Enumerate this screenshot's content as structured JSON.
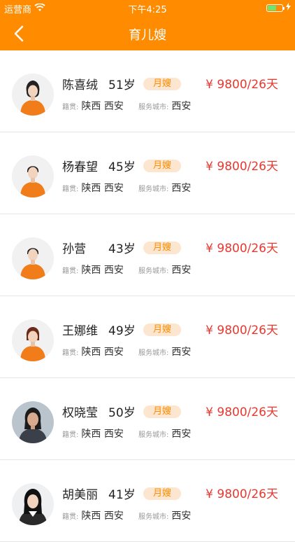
{
  "status_bar": {
    "carrier": "运营商",
    "time": "下午4:25",
    "battery_level": 0.55
  },
  "nav": {
    "title": "育儿嫂"
  },
  "colors": {
    "brand": "#ff8c00",
    "price": "#e8382f",
    "badge_bg": "#fde6cf"
  },
  "labels": {
    "origin": "籍贯:",
    "service_city": "服务城市:"
  },
  "nannies": [
    {
      "name": "陈喜绒",
      "age": "51岁",
      "type": "月嫂",
      "price": "¥ 9800/26天",
      "origin": "陕西 西安",
      "city": "西安"
    },
    {
      "name": "杨春望",
      "age": "45岁",
      "type": "月嫂",
      "price": "¥ 9800/26天",
      "origin": "陕西 西安",
      "city": "西安"
    },
    {
      "name": "孙营",
      "age": "43岁",
      "type": "月嫂",
      "price": "¥ 9800/26天",
      "origin": "陕西 西安",
      "city": "西安"
    },
    {
      "name": "王娜维",
      "age": "49岁",
      "type": "月嫂",
      "price": "¥ 9800/26天",
      "origin": "陕西 西安",
      "city": "西安"
    },
    {
      "name": "权晓莹",
      "age": "50岁",
      "type": "月嫂",
      "price": "¥ 9800/26天",
      "origin": "陕西 西安",
      "city": "西安"
    },
    {
      "name": "胡美丽",
      "age": "41岁",
      "type": "月嫂",
      "price": "¥ 9800/26天",
      "origin": "陕西 西安",
      "city": "西安"
    }
  ]
}
